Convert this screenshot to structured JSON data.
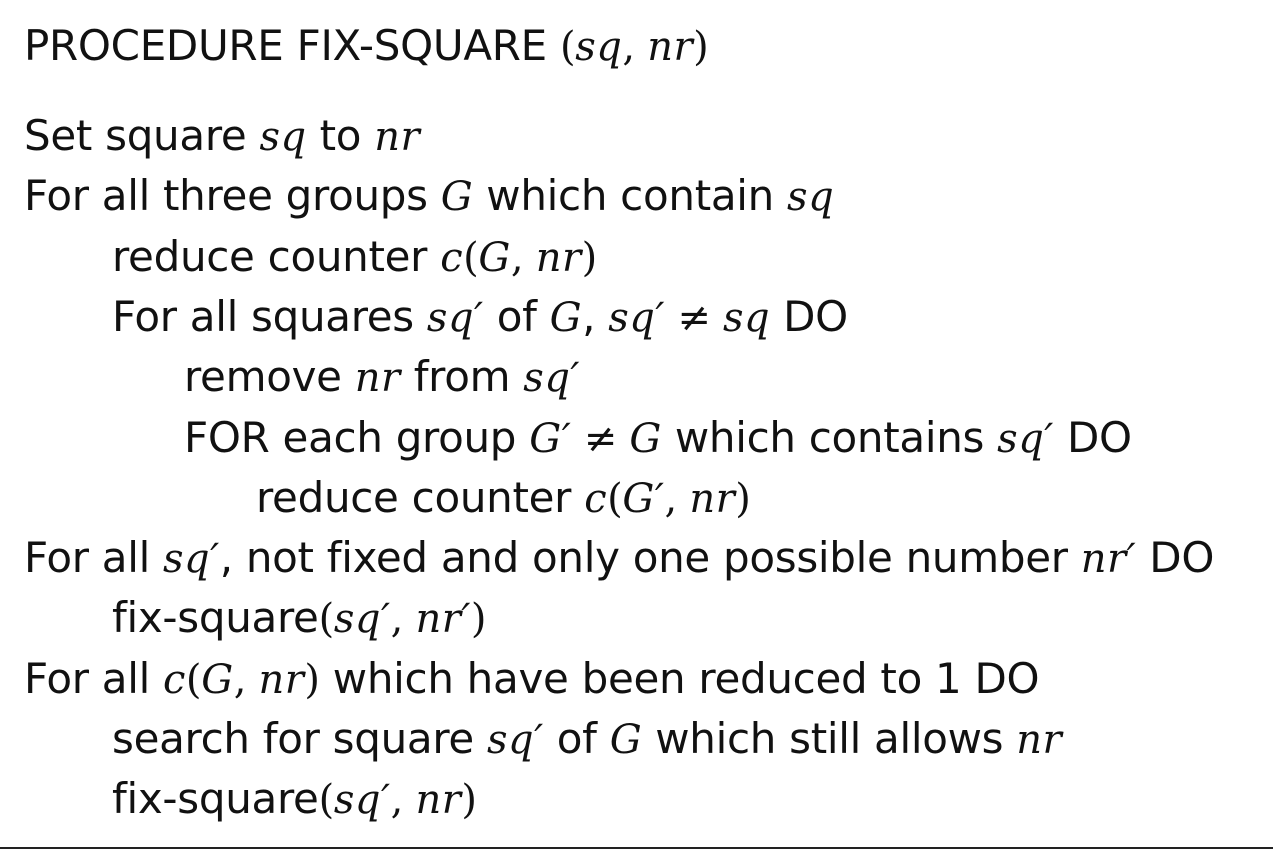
{
  "title": {
    "text": "PROCEDURE FIX-SQUARE",
    "args_open": "(",
    "arg1": "sq",
    "sep": ", ",
    "arg2": "nr",
    "args_close": ")"
  },
  "lines": [
    {
      "indent": 0,
      "parts": [
        {
          "t": "Set square ",
          "k": "text"
        },
        {
          "t": "sq",
          "k": "math"
        },
        {
          "t": " to ",
          "k": "text"
        },
        {
          "t": "nr",
          "k": "math"
        }
      ]
    },
    {
      "indent": 0,
      "parts": [
        {
          "t": "For all three groups ",
          "k": "text"
        },
        {
          "t": "G",
          "k": "math"
        },
        {
          "t": " which contain ",
          "k": "text"
        },
        {
          "t": "sq",
          "k": "math"
        }
      ]
    },
    {
      "indent": 1,
      "parts": [
        {
          "t": "reduce counter ",
          "k": "text"
        },
        {
          "t": "c",
          "k": "math"
        },
        {
          "t": "(",
          "k": "mathup"
        },
        {
          "t": "G",
          "k": "math"
        },
        {
          "t": ", ",
          "k": "mathup"
        },
        {
          "t": "nr",
          "k": "math"
        },
        {
          "t": ")",
          "k": "mathup"
        }
      ]
    },
    {
      "indent": 1,
      "parts": [
        {
          "t": "For all squares ",
          "k": "text"
        },
        {
          "t": "sq′",
          "k": "math"
        },
        {
          "t": " of ",
          "k": "text"
        },
        {
          "t": "G",
          "k": "math"
        },
        {
          "t": ", ",
          "k": "text"
        },
        {
          "t": "sq′",
          "k": "math"
        },
        {
          "t": " ≠ ",
          "k": "mathup"
        },
        {
          "t": "sq",
          "k": "math"
        },
        {
          "t": " DO",
          "k": "text"
        }
      ]
    },
    {
      "indent": 2,
      "parts": [
        {
          "t": "remove ",
          "k": "text"
        },
        {
          "t": "nr",
          "k": "math"
        },
        {
          "t": " from ",
          "k": "text"
        },
        {
          "t": "sq′",
          "k": "math"
        }
      ]
    },
    {
      "indent": 2,
      "parts": [
        {
          "t": "FOR each group ",
          "k": "text"
        },
        {
          "t": "G′",
          "k": "math"
        },
        {
          "t": " ≠ ",
          "k": "mathup"
        },
        {
          "t": "G",
          "k": "math"
        },
        {
          "t": " which contains ",
          "k": "text"
        },
        {
          "t": "sq′",
          "k": "math"
        },
        {
          "t": " DO",
          "k": "text"
        }
      ]
    },
    {
      "indent": 3,
      "parts": [
        {
          "t": "reduce counter ",
          "k": "text"
        },
        {
          "t": "c",
          "k": "math"
        },
        {
          "t": "(",
          "k": "mathup"
        },
        {
          "t": "G′",
          "k": "math"
        },
        {
          "t": ", ",
          "k": "mathup"
        },
        {
          "t": "nr",
          "k": "math"
        },
        {
          "t": ")",
          "k": "mathup"
        }
      ]
    },
    {
      "indent": 0,
      "parts": [
        {
          "t": "For all ",
          "k": "text"
        },
        {
          "t": "sq′",
          "k": "math"
        },
        {
          "t": ", not fixed and only one possible number ",
          "k": "text"
        },
        {
          "t": "nr′",
          "k": "math"
        },
        {
          "t": " DO",
          "k": "text"
        }
      ]
    },
    {
      "indent": 1,
      "parts": [
        {
          "t": "fix-square",
          "k": "text"
        },
        {
          "t": "(",
          "k": "mathup"
        },
        {
          "t": "sq′",
          "k": "math"
        },
        {
          "t": ", ",
          "k": "mathup"
        },
        {
          "t": "nr′",
          "k": "math"
        },
        {
          "t": ")",
          "k": "mathup"
        }
      ]
    },
    {
      "indent": 0,
      "parts": [
        {
          "t": "For all ",
          "k": "text"
        },
        {
          "t": "c",
          "k": "math"
        },
        {
          "t": "(",
          "k": "mathup"
        },
        {
          "t": "G",
          "k": "math"
        },
        {
          "t": ", ",
          "k": "mathup"
        },
        {
          "t": "nr",
          "k": "math"
        },
        {
          "t": ")",
          "k": "mathup"
        },
        {
          "t": " which have been reduced to 1 DO",
          "k": "text"
        }
      ]
    },
    {
      "indent": 1,
      "parts": [
        {
          "t": "search for square ",
          "k": "text"
        },
        {
          "t": "sq′",
          "k": "math"
        },
        {
          "t": " of ",
          "k": "text"
        },
        {
          "t": "G",
          "k": "math"
        },
        {
          "t": " which still allows ",
          "k": "text"
        },
        {
          "t": "nr",
          "k": "math"
        }
      ]
    },
    {
      "indent": 1,
      "parts": [
        {
          "t": "fix-square",
          "k": "text"
        },
        {
          "t": "(",
          "k": "mathup"
        },
        {
          "t": "sq′",
          "k": "math"
        },
        {
          "t": ", ",
          "k": "mathup"
        },
        {
          "t": "nr",
          "k": "math"
        },
        {
          "t": ")",
          "k": "mathup"
        }
      ]
    }
  ]
}
